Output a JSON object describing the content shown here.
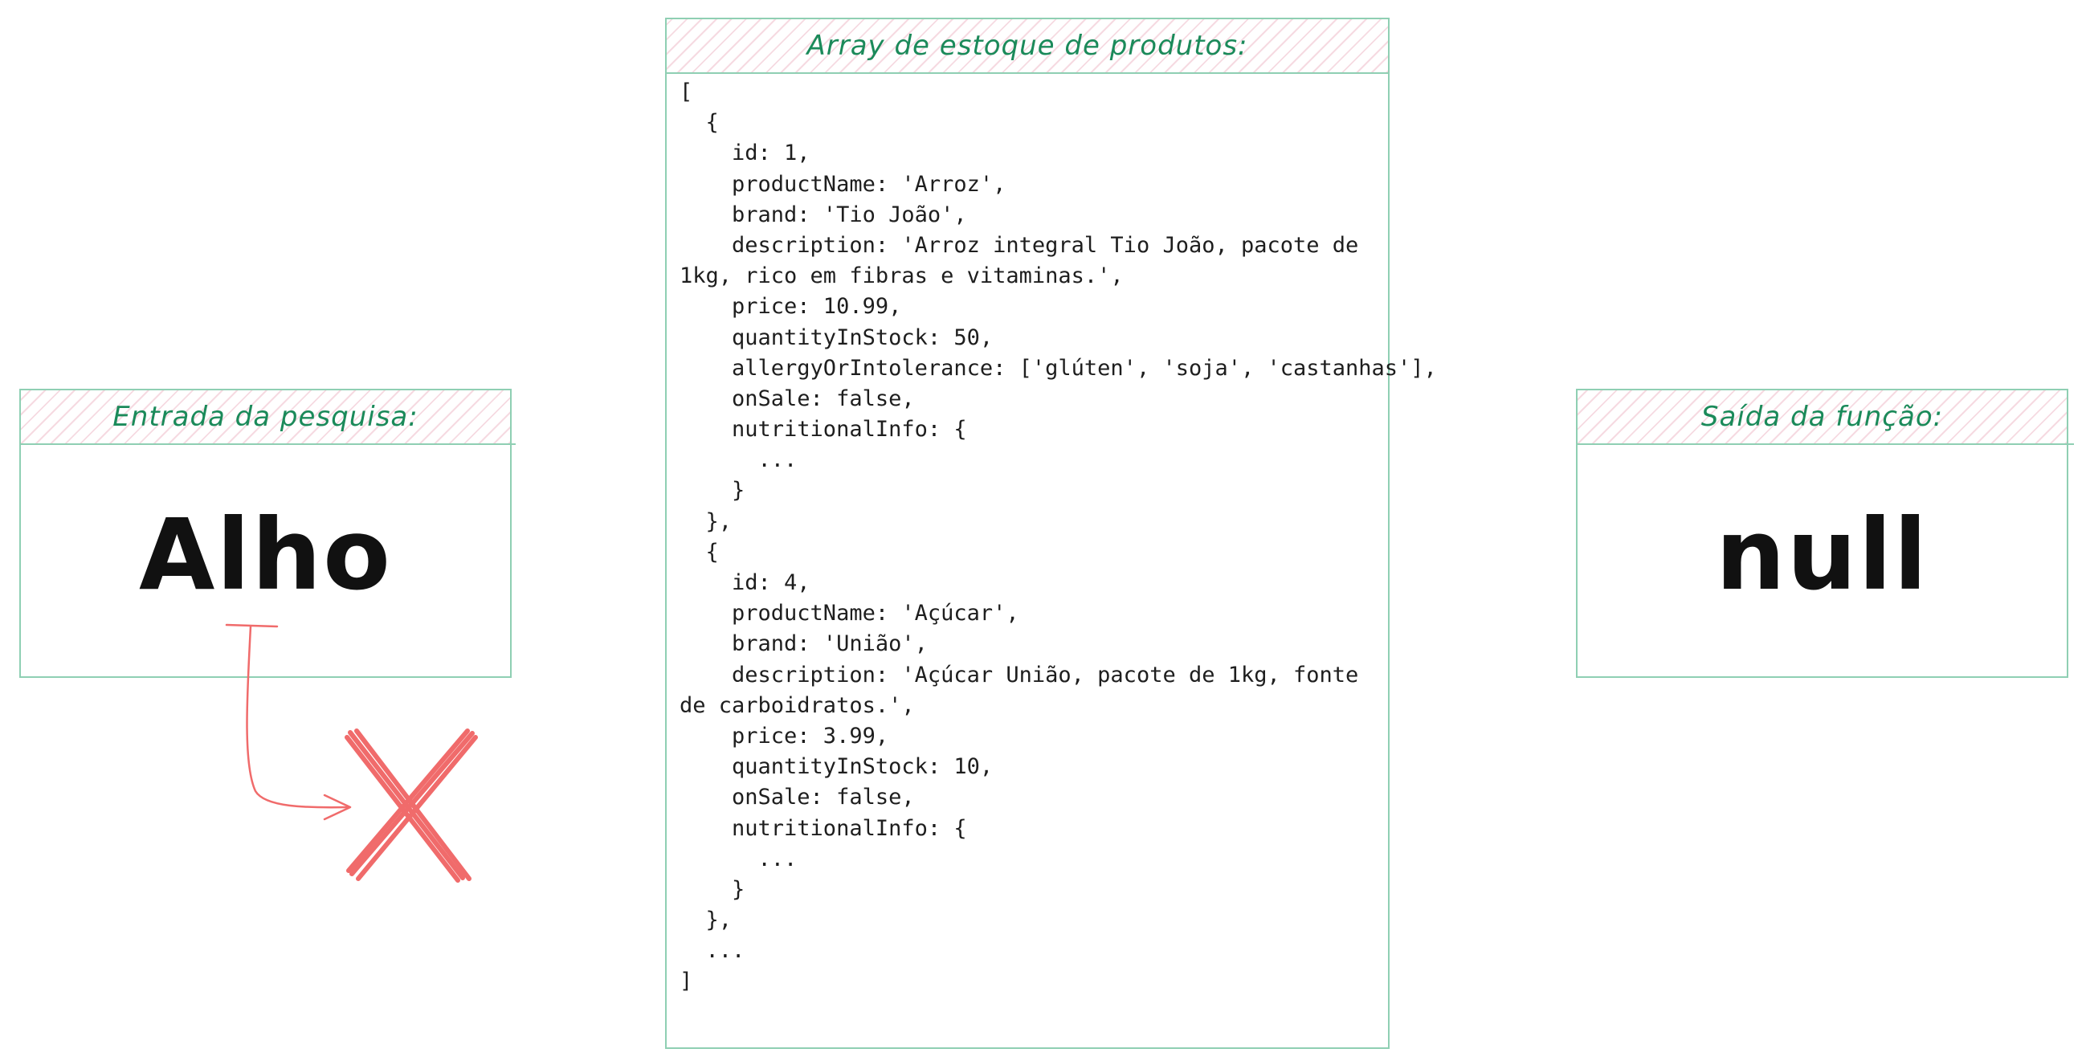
{
  "input_panel": {
    "title": "Entrada da pesquisa:",
    "value": "Alho"
  },
  "array_panel": {
    "title": "Array de estoque de produtos:",
    "code_lines": [
      "[",
      "  {",
      "    id: 1,",
      "    productName: 'Arroz',",
      "    brand: 'Tio João',",
      "    description: 'Arroz integral Tio João, pacote de",
      "1kg, rico em fibras e vitaminas.',",
      "    price: 10.99,",
      "    quantityInStock: 50,",
      "    allergyOrIntolerance: ['glúten', 'soja', 'castanhas'],",
      "    onSale: false,",
      "    nutritionalInfo: {",
      "      ...",
      "    }",
      "  },",
      "  {",
      "    id: 4,",
      "    productName: 'Açúcar',",
      "    brand: 'União',",
      "    description: 'Açúcar União, pacote de 1kg, fonte",
      "de carboidratos.',",
      "    price: 3.99,",
      "    quantityInStock: 10,",
      "    onSale: false,",
      "    nutritionalInfo: {",
      "      ...",
      "    }",
      "  },",
      "  ...",
      "]"
    ]
  },
  "output_panel": {
    "title": "Saída da função:",
    "value": "null"
  },
  "colors": {
    "panel_border": "#8fcfb3",
    "title_text": "#1b8a5a",
    "header_hatch": "#e696aa",
    "no_match_mark": "#f06b6b"
  },
  "icons": [
    "arrow-icon",
    "cross-icon"
  ]
}
